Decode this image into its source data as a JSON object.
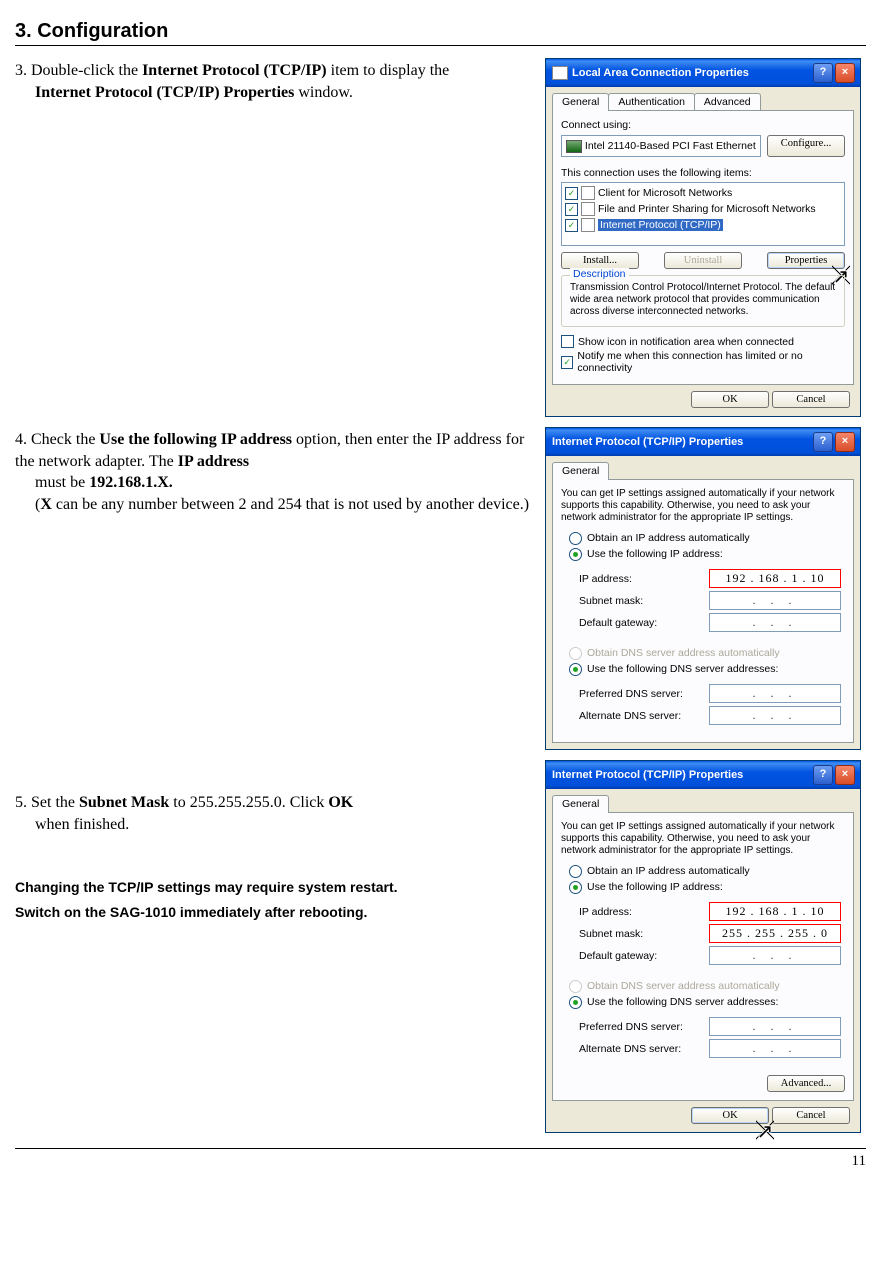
{
  "header": "3. Configuration",
  "page_number": "11",
  "step3": {
    "num": "3. ",
    "t1": "Double-click the ",
    "b1": "Internet Protocol (TCP/IP)",
    "t2": " item to display the ",
    "b2": "Internet Protocol (TCP/IP) Properties",
    "t3": " window."
  },
  "step4": {
    "num": "4. ",
    "t1": "Check the ",
    "b1": "Use the following IP address",
    "t2": " option, then enter the IP address for the network adapter. The ",
    "b2": "IP address",
    "t3": " must be ",
    "b3": "192.168.1.X.",
    "t4": "(",
    "b4": "X",
    "t5": " can be any number between 2 and 254 that is not used by another device.)"
  },
  "step5": {
    "num": "5. ",
    "t1": "Set the ",
    "b1": "Subnet Mask",
    "t2": " to 255.255.255.0. Click ",
    "b2": "OK",
    "t3": " when finished."
  },
  "notes": {
    "l1": "Changing the TCP/IP settings may require system restart.",
    "l2": "Switch on the SAG-1010 immediately after rebooting."
  },
  "dlg1": {
    "title": "Local Area Connection Properties",
    "tabs": {
      "general": "General",
      "auth": "Authentication",
      "adv": "Advanced"
    },
    "connect_using": "Connect using:",
    "adapter": "Intel 21140-Based PCI Fast Ethernet",
    "configure": "Configure...",
    "uses": "This connection uses the following items:",
    "item1": "Client for Microsoft Networks",
    "item2": "File and Printer Sharing for Microsoft Networks",
    "item3": "Internet Protocol (TCP/IP)",
    "install": "Install...",
    "uninstall": "Uninstall",
    "properties": "Properties",
    "desc_h": "Description",
    "desc": "Transmission Control Protocol/Internet Protocol. The default wide area network protocol that provides communication across diverse interconnected networks.",
    "opt1": "Show icon in notification area when connected",
    "opt2": "Notify me when this connection has limited or no connectivity",
    "ok": "OK",
    "cancel": "Cancel"
  },
  "dlg2": {
    "title": "Internet Protocol (TCP/IP) Properties",
    "tab": "General",
    "intro": "You can get IP settings assigned automatically if your network supports this capability. Otherwise, you need to ask your network administrator for the appropriate IP settings.",
    "r1": "Obtain an IP address automatically",
    "r2": "Use the following IP address:",
    "ip_l": "IP address:",
    "ip_v": "192 . 168  .   1   . 10",
    "sm_l": "Subnet mask:",
    "sm_empty": ".       .       .",
    "gw_l": "Default gateway:",
    "gw_empty": ".       .       .",
    "r3": "Obtain DNS server address automatically",
    "r4": "Use the following DNS server addresses:",
    "pdns": "Preferred DNS server:",
    "adns": "Alternate DNS server:",
    "dns_empty": ".       .       ."
  },
  "dlg3": {
    "title": "Internet Protocol (TCP/IP) Properties",
    "tab": "General",
    "intro": "You can get IP settings assigned automatically if your network supports this capability. Otherwise, you need to ask your network administrator for the appropriate IP settings.",
    "r1": "Obtain an IP address automatically",
    "r2": "Use the following IP address:",
    "ip_l": "IP address:",
    "ip_v": "192 . 168  .   1   . 10",
    "sm_l": "Subnet mask:",
    "sm_v": "255 . 255 . 255 .   0",
    "gw_l": "Default gateway:",
    "gw_empty": ".       .       .",
    "r3": "Obtain DNS server address automatically",
    "r4": "Use the following DNS server addresses:",
    "pdns": "Preferred DNS server:",
    "adns": "Alternate DNS server:",
    "dns_empty": ".       .       .",
    "advanced": "Advanced...",
    "ok": "OK",
    "cancel": "Cancel"
  }
}
